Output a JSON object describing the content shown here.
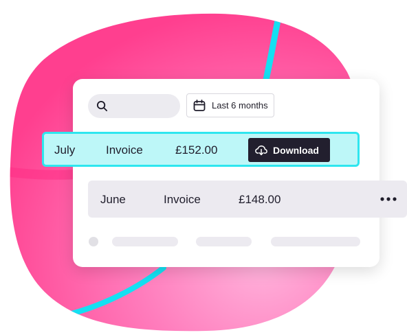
{
  "search": {
    "icon": "search-icon"
  },
  "filter": {
    "label": "Last 6 months",
    "icon": "calendar-icon"
  },
  "rows": [
    {
      "month": "July",
      "type": "Invoice",
      "amount": "£152.00",
      "action_label": "Download",
      "action_icon": "download-cloud-icon",
      "highlighted": true
    },
    {
      "month": "June",
      "type": "Invoice",
      "amount": "£148.00",
      "menu_icon": "more-horizontal-icon",
      "highlighted": false
    }
  ],
  "colors": {
    "blob_pink": "#fb5aa0",
    "highlight_fill": "#bdf7f8",
    "highlight_border": "#2ee6ef",
    "button_dark": "#221f2e",
    "stripe_cyan": "#14e0f2"
  }
}
